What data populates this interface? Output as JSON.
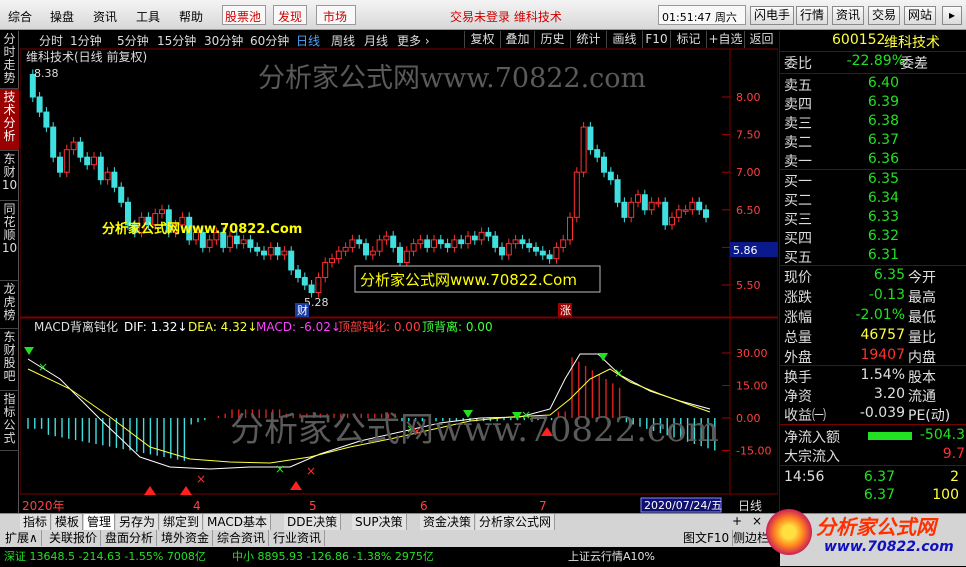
{
  "menu": {
    "items": [
      "综合",
      "操盘",
      "资讯",
      "工具",
      "帮助"
    ],
    "red_items": [
      "股票池",
      "发现",
      "市场"
    ],
    "status": "交易未登录  维科技术",
    "time": "01:51:47 周六",
    "right_buttons": [
      "闪电手",
      "行情",
      "资讯",
      "交易",
      "网站"
    ]
  },
  "left_tabs": [
    {
      "label": "分时走势"
    },
    {
      "label": "技术分析"
    },
    {
      "label": "东财10"
    },
    {
      "label": "同花顺10"
    },
    {
      "label": "龙虎榜"
    },
    {
      "label": "东财股吧"
    },
    {
      "label": "指标公式"
    }
  ],
  "period_bar": {
    "periods": [
      "分时",
      "1分钟",
      "5分钟",
      "15分钟",
      "30分钟",
      "60分钟",
      "日线",
      "周线",
      "月线",
      "更多 ›"
    ],
    "selected": "日线",
    "buttons": [
      "复权",
      "叠加",
      "历史",
      "统计",
      "画线",
      "F10",
      "标记",
      "+自选",
      "返回"
    ]
  },
  "kline": {
    "title": "维科技术(日线 前复权)",
    "high_label": "8.38",
    "low_label": "5.28",
    "price_ticks": [
      "8.00",
      "7.50",
      "7.00",
      "6.50",
      "6.00",
      "5.50"
    ],
    "current_price_box": "5.86",
    "marker_cai": "财",
    "marker_zhang": "涨",
    "watermark_top": "分析家公式网www.70822.com",
    "watermark_yellow": "分析家公式网www.70822.Com",
    "watermark_box": "分析家公式网www.70822.Com"
  },
  "macd": {
    "name": "MACD背离钝化",
    "dif": "DIF: 1.32↓",
    "dea": "DEA: 4.32↓",
    "macd": "MACD: -6.02↓",
    "top_dull": "顶部钝化: 0.00",
    "top_div": "顶背离: 0.00",
    "ticks": [
      "30.00",
      "15.00",
      "0.00",
      "-15.00"
    ],
    "watermark": "分析家公式网www.70822.com"
  },
  "time_axis": {
    "labels": [
      "2020年",
      "4",
      "5",
      "6",
      "7"
    ],
    "date_box": "2020/07/24/五",
    "period": "日线"
  },
  "right": {
    "code": "600152",
    "name": "维科技术",
    "weibi_label": "委比",
    "weibi": "-22.89%",
    "weicha_label": "委差",
    "asks": [
      {
        "label": "卖五",
        "price": "6.40"
      },
      {
        "label": "卖四",
        "price": "6.39"
      },
      {
        "label": "卖三",
        "price": "6.38"
      },
      {
        "label": "卖二",
        "price": "6.37"
      },
      {
        "label": "卖一",
        "price": "6.36"
      }
    ],
    "bids": [
      {
        "label": "买一",
        "price": "6.35"
      },
      {
        "label": "买二",
        "price": "6.34"
      },
      {
        "label": "买三",
        "price": "6.33"
      },
      {
        "label": "买四",
        "price": "6.32"
      },
      {
        "label": "买五",
        "price": "6.31"
      }
    ],
    "stats": [
      {
        "l": "现价",
        "v": "6.35",
        "r": "今开",
        "vc": "g"
      },
      {
        "l": "涨跌",
        "v": "-0.13",
        "r": "最高",
        "vc": "g"
      },
      {
        "l": "涨幅",
        "v": "-2.01%",
        "r": "最低",
        "vc": "g"
      },
      {
        "l": "总量",
        "v": "46757",
        "r": "量比",
        "vc": "y"
      },
      {
        "l": "外盘",
        "v": "19407",
        "r": "内盘",
        "vc": "r"
      }
    ],
    "stats2": [
      {
        "l": "换手",
        "v": "1.54%",
        "r": "股本",
        "vc": "w"
      },
      {
        "l": "净资",
        "v": "3.20",
        "r": "流通",
        "vc": "w"
      },
      {
        "l": "收益㈠",
        "v": "-0.039",
        "r": "PE(动)",
        "vc": "w"
      }
    ],
    "flow": [
      {
        "l": "净流入额",
        "v": "-504.3",
        "vc": "g"
      },
      {
        "l": "大宗流入",
        "v": "9.7",
        "vc": "r"
      }
    ],
    "ticks": [
      {
        "t": "14:56",
        "p": "6.37",
        "v": "2"
      },
      {
        "t": "",
        "p": "6.37",
        "v": "100"
      },
      {
        "t": "",
        "p": "",
        "v": ""
      }
    ]
  },
  "bottom": {
    "tabs": [
      "指标",
      "模板",
      "管理",
      "另存为",
      "绑定到",
      "MACD基本",
      "DDE决策",
      "SUP决策",
      "资金决策",
      "分析家公式网"
    ],
    "selected": "管理",
    "row2": [
      "扩展∧",
      "关联报价",
      "盘面分析",
      "境外资金",
      "综合资讯",
      "行业资讯"
    ],
    "status_left": "深证  13648.5  -214.63  -1.55%  7008亿",
    "status_mid": "中小  8895.93  -126.86  -1.38%  2975亿",
    "status_right": "上证云行情A10%",
    "status_f10": "图文F10",
    "status_side": "侧边栏",
    "brand": "分析家公式网",
    "brand_url": "www.70822.com"
  }
}
